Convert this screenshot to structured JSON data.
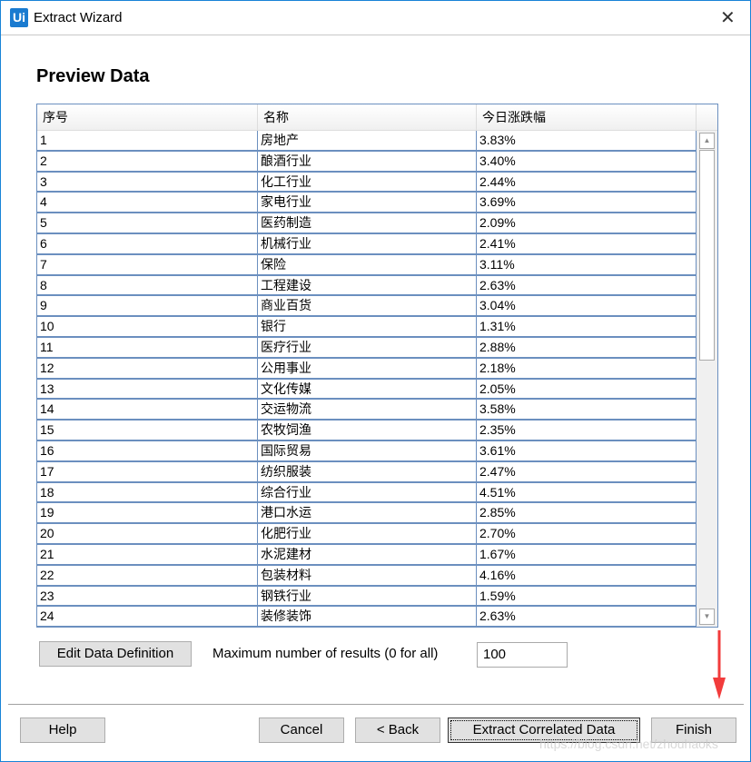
{
  "window": {
    "title": "Extract Wizard",
    "logo": "Ui",
    "close_icon": "close-icon"
  },
  "page_title": "Preview Data",
  "table": {
    "columns": [
      "序号",
      "名称",
      "今日涨跌幅"
    ],
    "rows": [
      [
        "1",
        "房地产",
        "3.83%"
      ],
      [
        "2",
        "酿酒行业",
        "3.40%"
      ],
      [
        "3",
        "化工行业",
        "2.44%"
      ],
      [
        "4",
        "家电行业",
        "3.69%"
      ],
      [
        "5",
        "医药制造",
        "2.09%"
      ],
      [
        "6",
        "机械行业",
        "2.41%"
      ],
      [
        "7",
        "保险",
        "3.11%"
      ],
      [
        "8",
        "工程建设",
        "2.63%"
      ],
      [
        "9",
        "商业百货",
        "3.04%"
      ],
      [
        "10",
        "银行",
        "1.31%"
      ],
      [
        "11",
        "医疗行业",
        "2.88%"
      ],
      [
        "12",
        "公用事业",
        "2.18%"
      ],
      [
        "13",
        "文化传媒",
        "2.05%"
      ],
      [
        "14",
        "交运物流",
        "3.58%"
      ],
      [
        "15",
        "农牧饲渔",
        "2.35%"
      ],
      [
        "16",
        "国际贸易",
        "3.61%"
      ],
      [
        "17",
        "纺织服装",
        "2.47%"
      ],
      [
        "18",
        "综合行业",
        "4.51%"
      ],
      [
        "19",
        "港口水运",
        "2.85%"
      ],
      [
        "20",
        "化肥行业",
        "2.70%"
      ],
      [
        "21",
        "水泥建材",
        "1.67%"
      ],
      [
        "22",
        "包装材料",
        "4.16%"
      ],
      [
        "23",
        "钢铁行业",
        "1.59%"
      ],
      [
        "24",
        "装修装饰",
        "2.63%"
      ]
    ]
  },
  "controls": {
    "edit_button": "Edit Data Definition",
    "max_label": "Maximum number of results (0 for all)",
    "max_value": "100"
  },
  "footer": {
    "help": "Help",
    "cancel": "Cancel",
    "back": "< Back",
    "extract": "Extract Correlated Data",
    "finish": "Finish"
  },
  "watermark": "https://blog.csdn.net/zhouhaoks",
  "colors": {
    "accent": "#1a7bd0",
    "arrow": "#f23c3c",
    "grid": "#6b8fbf"
  }
}
